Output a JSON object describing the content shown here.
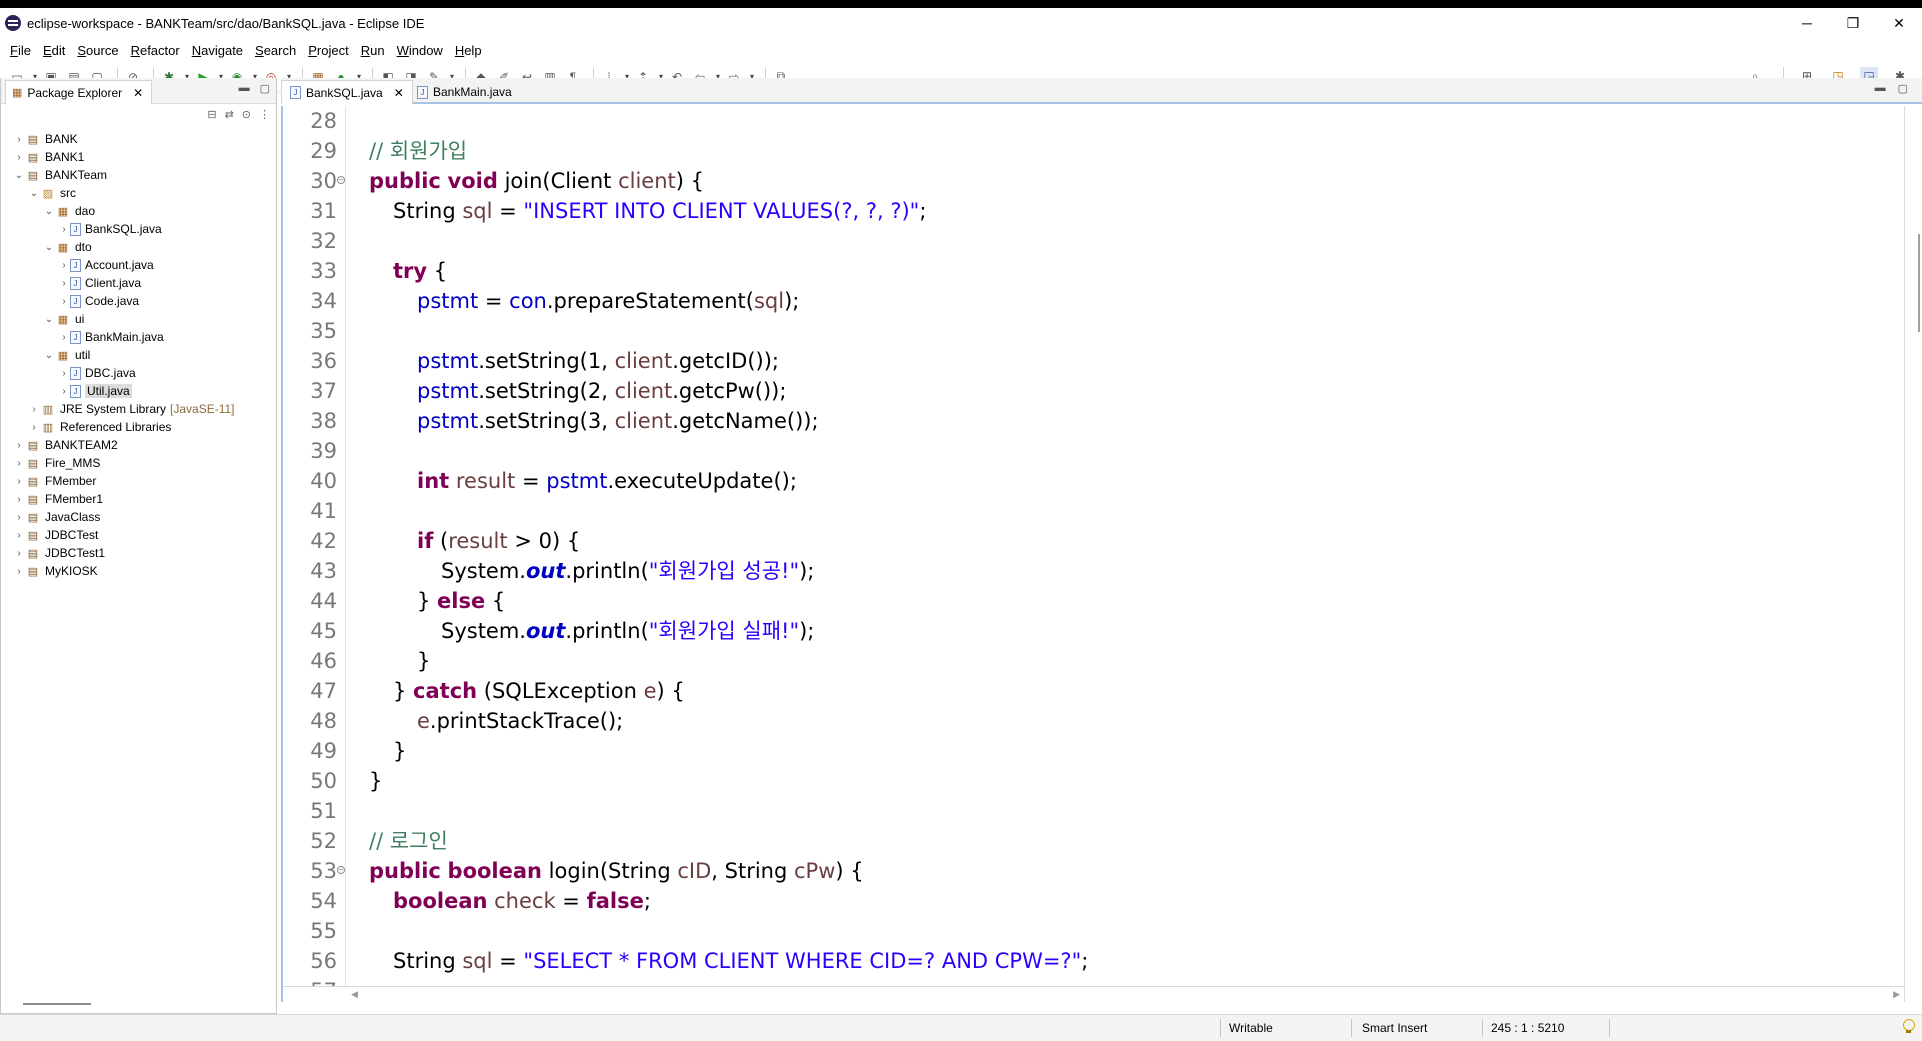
{
  "window": {
    "title": "eclipse-workspace - BANKTeam/src/dao/BankSQL.java - Eclipse IDE",
    "minimize": "─",
    "maximize": "❐",
    "close": "✕"
  },
  "menu": [
    "File",
    "Edit",
    "Source",
    "Refactor",
    "Navigate",
    "Search",
    "Project",
    "Run",
    "Window",
    "Help"
  ],
  "explorer": {
    "tab_label": "Package Explorer",
    "tree": [
      {
        "label": "BANK",
        "depth": 0,
        "arrow": "›",
        "icon": "project"
      },
      {
        "label": "BANK1",
        "depth": 0,
        "arrow": "›",
        "icon": "project"
      },
      {
        "label": "BANKTeam",
        "depth": 0,
        "arrow": "⌄",
        "icon": "project"
      },
      {
        "label": "src",
        "depth": 1,
        "arrow": "⌄",
        "icon": "folder"
      },
      {
        "label": "dao",
        "depth": 2,
        "arrow": "⌄",
        "icon": "package"
      },
      {
        "label": "BankSQL.java",
        "depth": 3,
        "arrow": "›",
        "icon": "file"
      },
      {
        "label": "dto",
        "depth": 2,
        "arrow": "⌄",
        "icon": "package"
      },
      {
        "label": "Account.java",
        "depth": 3,
        "arrow": "›",
        "icon": "file"
      },
      {
        "label": "Client.java",
        "depth": 3,
        "arrow": "›",
        "icon": "file"
      },
      {
        "label": "Code.java",
        "depth": 3,
        "arrow": "›",
        "icon": "file"
      },
      {
        "label": "ui",
        "depth": 2,
        "arrow": "⌄",
        "icon": "package"
      },
      {
        "label": "BankMain.java",
        "depth": 3,
        "arrow": "›",
        "icon": "file"
      },
      {
        "label": "util",
        "depth": 2,
        "arrow": "⌄",
        "icon": "package"
      },
      {
        "label": "DBC.java",
        "depth": 3,
        "arrow": "›",
        "icon": "file"
      },
      {
        "label": "Util.java",
        "depth": 3,
        "arrow": "›",
        "icon": "file",
        "selected": true
      },
      {
        "label": "JRE System Library",
        "extra": "[JavaSE-11]",
        "depth": 1,
        "arrow": "›",
        "icon": "lib"
      },
      {
        "label": "Referenced Libraries",
        "depth": 1,
        "arrow": "›",
        "icon": "lib"
      },
      {
        "label": "BANKTEAM2",
        "depth": 0,
        "arrow": "›",
        "icon": "project"
      },
      {
        "label": "Fire_MMS",
        "depth": 0,
        "arrow": "›",
        "icon": "project"
      },
      {
        "label": "FMember",
        "depth": 0,
        "arrow": "›",
        "icon": "project"
      },
      {
        "label": "FMember1",
        "depth": 0,
        "arrow": "›",
        "icon": "project"
      },
      {
        "label": "JavaClass",
        "depth": 0,
        "arrow": "›",
        "icon": "project"
      },
      {
        "label": "JDBCTest",
        "depth": 0,
        "arrow": "›",
        "icon": "project"
      },
      {
        "label": "JDBCTest1",
        "depth": 0,
        "arrow": "›",
        "icon": "project"
      },
      {
        "label": "MyKIOSK",
        "depth": 0,
        "arrow": "›",
        "icon": "project"
      }
    ]
  },
  "editor": {
    "tabs": [
      {
        "label": "BankSQL.java",
        "active": true
      },
      {
        "label": "BankMain.java",
        "active": false
      }
    ],
    "lines": [
      {
        "n": "28",
        "indent": 0,
        "tokens": []
      },
      {
        "n": "29",
        "indent": 0,
        "tokens": [
          {
            "t": "// 회원가입",
            "c": "cmt"
          }
        ]
      },
      {
        "n": "30",
        "indent": 0,
        "fold": true,
        "tokens": [
          {
            "t": "public",
            "c": "kw"
          },
          {
            "t": " "
          },
          {
            "t": "void",
            "c": "kw"
          },
          {
            "t": " join(Client "
          },
          {
            "t": "client",
            "c": "var"
          },
          {
            "t": ") {"
          }
        ]
      },
      {
        "n": "31",
        "indent": 1,
        "tokens": [
          {
            "t": "String "
          },
          {
            "t": "sql",
            "c": "var"
          },
          {
            "t": " = "
          },
          {
            "t": "\"INSERT INTO CLIENT VALUES(?, ?, ?)\"",
            "c": "str"
          },
          {
            "t": ";"
          }
        ]
      },
      {
        "n": "32",
        "indent": 0,
        "tokens": []
      },
      {
        "n": "33",
        "indent": 1,
        "tokens": [
          {
            "t": "try",
            "c": "kw"
          },
          {
            "t": " {"
          }
        ]
      },
      {
        "n": "34",
        "indent": 2,
        "tokens": [
          {
            "t": "pstmt",
            "c": "fld"
          },
          {
            "t": " = "
          },
          {
            "t": "con",
            "c": "fld"
          },
          {
            "t": ".prepareStatement("
          },
          {
            "t": "sql",
            "c": "var"
          },
          {
            "t": ");"
          }
        ]
      },
      {
        "n": "35",
        "indent": 0,
        "tokens": []
      },
      {
        "n": "36",
        "indent": 2,
        "tokens": [
          {
            "t": "pstmt",
            "c": "fld"
          },
          {
            "t": ".setString(1, "
          },
          {
            "t": "client",
            "c": "var"
          },
          {
            "t": ".getcID());"
          }
        ]
      },
      {
        "n": "37",
        "indent": 2,
        "tokens": [
          {
            "t": "pstmt",
            "c": "fld"
          },
          {
            "t": ".setString(2, "
          },
          {
            "t": "client",
            "c": "var"
          },
          {
            "t": ".getcPw());"
          }
        ]
      },
      {
        "n": "38",
        "indent": 2,
        "tokens": [
          {
            "t": "pstmt",
            "c": "fld"
          },
          {
            "t": ".setString(3, "
          },
          {
            "t": "client",
            "c": "var"
          },
          {
            "t": ".getcName());"
          }
        ]
      },
      {
        "n": "39",
        "indent": 0,
        "tokens": []
      },
      {
        "n": "40",
        "indent": 2,
        "tokens": [
          {
            "t": "int",
            "c": "kw"
          },
          {
            "t": " "
          },
          {
            "t": "result",
            "c": "var"
          },
          {
            "t": " = "
          },
          {
            "t": "pstmt",
            "c": "fld"
          },
          {
            "t": ".executeUpdate();"
          }
        ]
      },
      {
        "n": "41",
        "indent": 0,
        "tokens": []
      },
      {
        "n": "42",
        "indent": 2,
        "tokens": [
          {
            "t": "if",
            "c": "kw"
          },
          {
            "t": " ("
          },
          {
            "t": "result",
            "c": "var"
          },
          {
            "t": " > 0) {"
          }
        ]
      },
      {
        "n": "43",
        "indent": 3,
        "tokens": [
          {
            "t": "System."
          },
          {
            "t": "out",
            "c": "sfld"
          },
          {
            "t": ".println("
          },
          {
            "t": "\"회원가입 성공!\"",
            "c": "str"
          },
          {
            "t": ");"
          }
        ]
      },
      {
        "n": "44",
        "indent": 2,
        "tokens": [
          {
            "t": "} "
          },
          {
            "t": "else",
            "c": "kw"
          },
          {
            "t": " {"
          }
        ]
      },
      {
        "n": "45",
        "indent": 3,
        "tokens": [
          {
            "t": "System."
          },
          {
            "t": "out",
            "c": "sfld"
          },
          {
            "t": ".println("
          },
          {
            "t": "\"회원가입 실패!\"",
            "c": "str"
          },
          {
            "t": ");"
          }
        ]
      },
      {
        "n": "46",
        "indent": 2,
        "tokens": [
          {
            "t": "}"
          }
        ]
      },
      {
        "n": "47",
        "indent": 1,
        "tokens": [
          {
            "t": "} "
          },
          {
            "t": "catch",
            "c": "kw"
          },
          {
            "t": " (SQLException "
          },
          {
            "t": "e",
            "c": "var"
          },
          {
            "t": ") {"
          }
        ]
      },
      {
        "n": "48",
        "indent": 2,
        "tokens": [
          {
            "t": "e",
            "c": "var"
          },
          {
            "t": ".printStackTrace();"
          }
        ]
      },
      {
        "n": "49",
        "indent": 1,
        "tokens": [
          {
            "t": "}"
          }
        ]
      },
      {
        "n": "50",
        "indent": 0,
        "tokens": [
          {
            "t": "}"
          }
        ]
      },
      {
        "n": "51",
        "indent": 0,
        "tokens": []
      },
      {
        "n": "52",
        "indent": 0,
        "tokens": [
          {
            "t": "// 로그인",
            "c": "cmt"
          }
        ]
      },
      {
        "n": "53",
        "indent": 0,
        "fold": true,
        "tokens": [
          {
            "t": "public",
            "c": "kw"
          },
          {
            "t": " "
          },
          {
            "t": "boolean",
            "c": "kw"
          },
          {
            "t": " login(String "
          },
          {
            "t": "cID",
            "c": "var"
          },
          {
            "t": ", String "
          },
          {
            "t": "cPw",
            "c": "var"
          },
          {
            "t": ") {"
          }
        ]
      },
      {
        "n": "54",
        "indent": 1,
        "tokens": [
          {
            "t": "boolean",
            "c": "kw"
          },
          {
            "t": " "
          },
          {
            "t": "check",
            "c": "var"
          },
          {
            "t": " = "
          },
          {
            "t": "false",
            "c": "kw"
          },
          {
            "t": ";"
          }
        ]
      },
      {
        "n": "55",
        "indent": 0,
        "tokens": []
      },
      {
        "n": "56",
        "indent": 1,
        "tokens": [
          {
            "t": "String "
          },
          {
            "t": "sql",
            "c": "var"
          },
          {
            "t": " = "
          },
          {
            "t": "\"SELECT * FROM CLIENT WHERE CID=? AND CPW=?\"",
            "c": "str"
          },
          {
            "t": ";"
          }
        ]
      },
      {
        "n": "57",
        "indent": 0,
        "tokens": []
      }
    ]
  },
  "status": {
    "mode": "Writable",
    "insert": "Smart Insert",
    "position": "245 : 1 : 5210"
  }
}
